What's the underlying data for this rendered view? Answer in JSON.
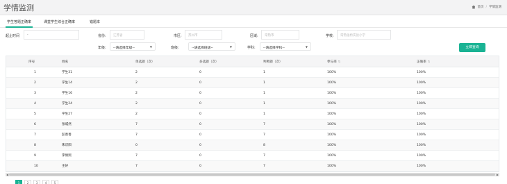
{
  "page": {
    "title": "学情监测",
    "breadcrumb": {
      "home": "首页",
      "separator": "/",
      "current": "学情监测"
    }
  },
  "tabs": [
    {
      "label": "学生答题正确率",
      "active": true
    },
    {
      "label": "课堂学生综合正确率",
      "active": false
    },
    {
      "label": "错题本",
      "active": false
    }
  ],
  "filters": {
    "start_time": {
      "label": "起止时间",
      "value": "-",
      "placeholder": ""
    },
    "province": {
      "label": "省份:",
      "placeholder": "江苏省"
    },
    "city": {
      "label": "市区:",
      "placeholder": "苏州市"
    },
    "district": {
      "label": "区域:",
      "placeholder": "常熟市"
    },
    "school": {
      "label": "学校:",
      "placeholder": "常熟张桥实验小学"
    },
    "grade": {
      "label": "年级:",
      "value": "--请选择年级--"
    },
    "class": {
      "label": "班级:",
      "value": "--请选择班级--"
    },
    "subject": {
      "label": "学科:",
      "value": "--请选择学科--"
    },
    "query_button": "立即查询"
  },
  "table": {
    "columns": [
      "序号",
      "姓名",
      "单选题（次）",
      "多选题（次）",
      "判断题（次）",
      "参与率",
      "正确率"
    ],
    "rows": [
      [
        "1",
        "学生31",
        "2",
        "0",
        "1",
        "100%",
        "100%"
      ],
      [
        "2",
        "学生14",
        "2",
        "0",
        "1",
        "100%",
        "100%"
      ],
      [
        "3",
        "学生16",
        "2",
        "0",
        "1",
        "100%",
        "100%"
      ],
      [
        "4",
        "学生24",
        "2",
        "0",
        "1",
        "100%",
        "100%"
      ],
      [
        "5",
        "学生27",
        "2",
        "0",
        "1",
        "100%",
        "100%"
      ],
      [
        "6",
        "张城然",
        "7",
        "0",
        "7",
        "100%",
        "100%"
      ],
      [
        "7",
        "彭善善",
        "7",
        "0",
        "7",
        "100%",
        "100%"
      ],
      [
        "8",
        "朱识阳",
        "0",
        "0",
        "8",
        "100%",
        "100%"
      ],
      [
        "9",
        "李倩熙",
        "7",
        "0",
        "7",
        "100%",
        "100%"
      ],
      [
        "10",
        "王好",
        "7",
        "0",
        "7",
        "100%",
        "100%"
      ]
    ]
  },
  "pagination": {
    "pages": [
      "1",
      "2",
      "3",
      "4",
      "5"
    ],
    "current": "1"
  }
}
